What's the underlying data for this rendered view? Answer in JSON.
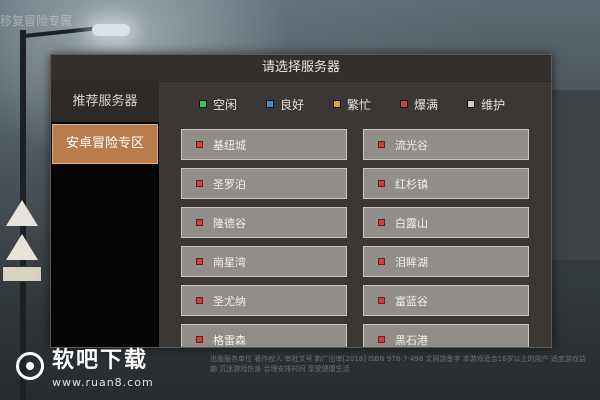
{
  "background": {
    "top_text": "移复冒险专属"
  },
  "dialog": {
    "title": "请选择服务器",
    "tabs": [
      {
        "label": "推荐服务器"
      },
      {
        "label": "安卓冒险专区"
      }
    ],
    "legend": [
      {
        "label": "空闲",
        "color": "#3cc45a"
      },
      {
        "label": "良好",
        "color": "#3a8ddc"
      },
      {
        "label": "繁忙",
        "color": "#e0a23a"
      },
      {
        "label": "爆满",
        "color": "#d23c3c"
      },
      {
        "label": "维护",
        "color": "#cccccc"
      }
    ],
    "servers": [
      {
        "name": "基纽城"
      },
      {
        "name": "流光谷"
      },
      {
        "name": "圣罗泊"
      },
      {
        "name": "红杉镇"
      },
      {
        "name": "隆德谷"
      },
      {
        "name": "白露山"
      },
      {
        "name": "南星湾"
      },
      {
        "name": "泪眸湖"
      },
      {
        "name": "圣尤纳"
      },
      {
        "name": "富蓝谷"
      },
      {
        "name": "格雷森"
      },
      {
        "name": "黑石港"
      }
    ]
  },
  "watermark": {
    "title": "软吧下载",
    "url": "www.ruan8.com"
  },
  "footer": {
    "text": "出版服务单位 著作权人 审批文号 新广出审[2018] ISBN 978-7-498 文网游备字 本游戏适合16岁以上的用户 适度游戏益脑 沉迷游戏伤身 合理安排时间 享受健康生活"
  }
}
